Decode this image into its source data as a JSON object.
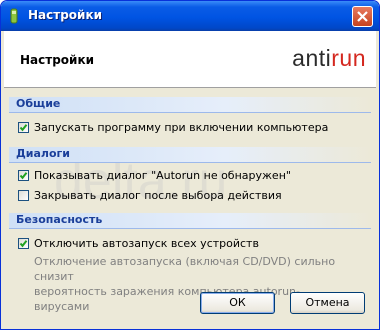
{
  "window": {
    "title": "Настройки"
  },
  "header": {
    "title": "Настройки",
    "logo_part1": "anti",
    "logo_part2": "run"
  },
  "watermark": "delta.ru",
  "sections": [
    {
      "title": "Общие",
      "options": [
        {
          "label": "Запускать программу при включении компьютера",
          "checked": true
        }
      ]
    },
    {
      "title": "Диалоги",
      "options": [
        {
          "label": "Показывать диалог \"Autorun не обнаружен\"",
          "checked": true
        },
        {
          "label": "Закрывать диалог после выбора действия",
          "checked": false
        }
      ]
    },
    {
      "title": "Безопасность",
      "options": [
        {
          "label": "Отключить автозапуск всех устройств",
          "checked": true
        }
      ],
      "note_line1": "Отключение автозапуска (включая CD/DVD) сильно снизит",
      "note_line2": "вероятность заражения компьютера autorun-вирусами"
    }
  ],
  "buttons": {
    "ok": "ОК",
    "cancel": "Отмена"
  },
  "colors": {
    "title_bar": "#0054e3",
    "logo_accent": "#d4281f",
    "section_title": "#1b3f9a"
  }
}
